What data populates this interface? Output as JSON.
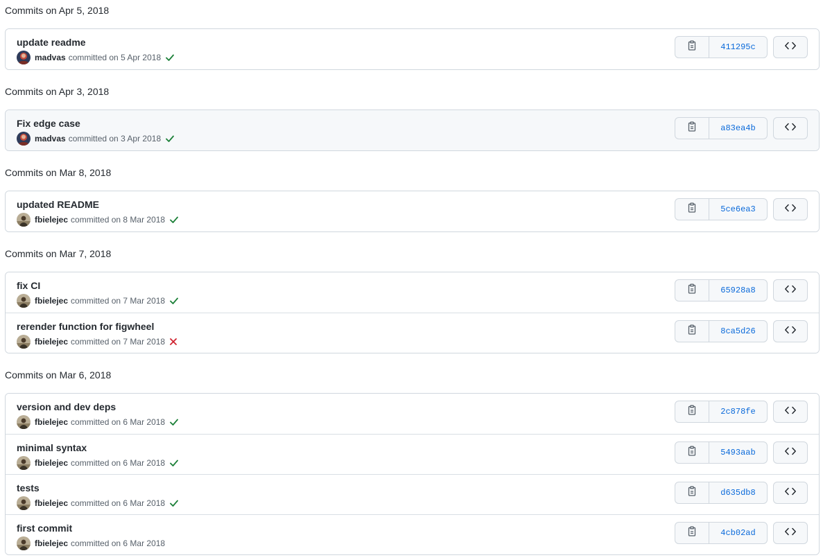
{
  "groups": [
    {
      "title": "Commits on Apr 5, 2018",
      "commits": [
        {
          "message": "update readme",
          "author": "madvas",
          "committed": "committed on 5 Apr 2018",
          "sha": "411295c",
          "status": "success",
          "avatar": "madvas"
        }
      ]
    },
    {
      "title": "Commits on Apr 3, 2018",
      "commits": [
        {
          "message": "Fix edge case",
          "author": "madvas",
          "committed": "committed on 3 Apr 2018",
          "sha": "a83ea4b",
          "status": "success",
          "avatar": "madvas"
        }
      ]
    },
    {
      "title": "Commits on Mar 8, 2018",
      "commits": [
        {
          "message": "updated README",
          "author": "fbielejec",
          "committed": "committed on 8 Mar 2018",
          "sha": "5ce6ea3",
          "status": "success",
          "avatar": "fbielejec"
        }
      ]
    },
    {
      "title": "Commits on Mar 7, 2018",
      "commits": [
        {
          "message": "fix CI",
          "author": "fbielejec",
          "committed": "committed on 7 Mar 2018",
          "sha": "65928a8",
          "status": "success",
          "avatar": "fbielejec"
        },
        {
          "message": "rerender function for figwheel",
          "author": "fbielejec",
          "committed": "committed on 7 Mar 2018",
          "sha": "8ca5d26",
          "status": "failure",
          "avatar": "fbielejec"
        }
      ]
    },
    {
      "title": "Commits on Mar 6, 2018",
      "commits": [
        {
          "message": "version and dev deps",
          "author": "fbielejec",
          "committed": "committed on 6 Mar 2018",
          "sha": "2c878fe",
          "status": "success",
          "avatar": "fbielejec"
        },
        {
          "message": "minimal syntax",
          "author": "fbielejec",
          "committed": "committed on 6 Mar 2018",
          "sha": "5493aab",
          "status": "success",
          "avatar": "fbielejec"
        },
        {
          "message": "tests",
          "author": "fbielejec",
          "committed": "committed on 6 Mar 2018",
          "sha": "d635db8",
          "status": "success",
          "avatar": "fbielejec"
        },
        {
          "message": "first commit",
          "author": "fbielejec",
          "committed": "committed on 6 Mar 2018",
          "sha": "4cb02ad",
          "status": "none",
          "avatar": "fbielejec"
        }
      ]
    }
  ],
  "icons": {
    "copy": "clipboard-icon",
    "browse": "code-icon",
    "success": "check-icon",
    "failure": "x-icon"
  },
  "colors": {
    "success": "#1a7f37",
    "failure": "#cf222e",
    "sha_link": "#0969da",
    "border": "#d0d7de",
    "row_hover": "#f6f8fa"
  }
}
